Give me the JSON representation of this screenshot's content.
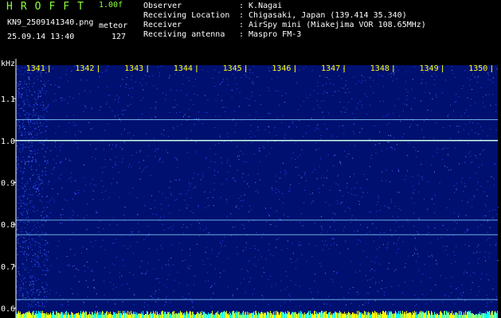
{
  "header": {
    "app_title": "HROFFT",
    "version": "1.00f",
    "filename": "KN9_2509141340.png",
    "mode": "meteor",
    "datetime": "25.09.14 13:40",
    "count": "127",
    "info": [
      {
        "label": "Observer",
        "value": ": K.Nagai"
      },
      {
        "label": "Receiving Location",
        "value": ": Chigasaki, Japan (139.414 35.340)"
      },
      {
        "label": "Receiver",
        "value": ": AirSpy mini (Miakejima VOR 108.65MHz)"
      },
      {
        "label": "Receiving antenna",
        "value": ": Maspro FM-3"
      }
    ]
  },
  "colors": {
    "title": "#8aff3a",
    "tick_label": "#ffff00",
    "y_tick_label": "#ffffff",
    "background": "#001070",
    "noise": "#2a4cff",
    "signal_line": "#c8ffe8",
    "bottom_bar_yellow": "#ffff00",
    "bottom_bar_cyan": "#00ffff"
  },
  "chart_data": {
    "type": "heatmap",
    "y_unit": "kHz",
    "x_ticks": [
      "1341",
      "1342",
      "1343",
      "1344",
      "1345",
      "1346",
      "1347",
      "1348",
      "1349",
      "1350"
    ],
    "y_ticks": [
      "1.1",
      "1.0",
      "0.9",
      "0.8",
      "0.7",
      "0.6"
    ],
    "y_range": [
      0.58,
      1.18
    ],
    "x_range": [
      1340.6,
      1350.4
    ],
    "signal_lines_khz": [
      1.05,
      1.0,
      0.81,
      0.775,
      0.62
    ]
  }
}
